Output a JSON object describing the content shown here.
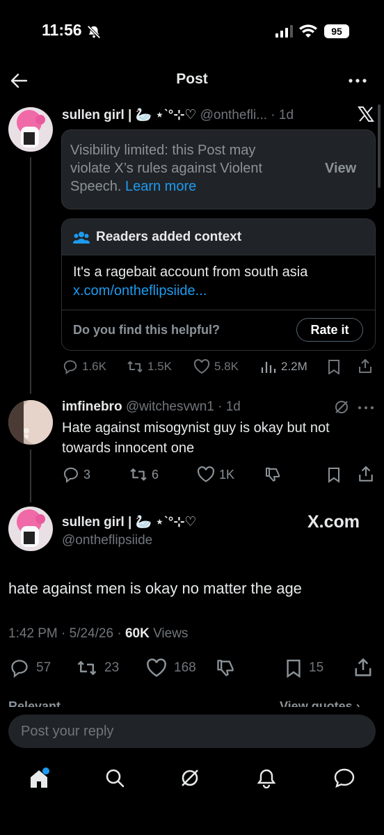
{
  "status_bar": {
    "time": "11:56",
    "battery": "95"
  },
  "header": {
    "title": "Post"
  },
  "post1": {
    "name": "sullen girl | 🦢 ⋆ˋ°⊹♡",
    "handle": "@onthefli...",
    "age": "· 1d",
    "limited": {
      "text_line1": "Visibility limited: this Post may",
      "text_line2": "violate X’s rules against Violent",
      "text_line3": "Speech.",
      "learn_more": "Learn more",
      "view_label": "View"
    },
    "context": {
      "title": "Readers added context",
      "text": "It's a ragebait account from south asia",
      "link": "x.com/ontheflipsiide...",
      "question": "Do you find this helpful?",
      "rate_label": "Rate it"
    },
    "actions": {
      "replies": "1.6K",
      "reposts": "1.5K",
      "likes": "5.8K",
      "views": "2.2M"
    }
  },
  "reply": {
    "name": "imfinebro",
    "handle": "@witchesvwn1",
    "age": "· 1d",
    "text_line1": "Hate against misogynist guy is okay but not",
    "text_line2": "towards innocent one",
    "actions": {
      "replies": "3",
      "reposts": "6",
      "likes": "1K"
    }
  },
  "main_post": {
    "name": "sullen girl | 🦢 ⋆ˋ°⊹♡",
    "handle": "@ontheflipsiide",
    "badge": "X.com",
    "text": "hate against men is okay no matter the age",
    "meta_time": "1:42 PM · 5/24/26 ·",
    "meta_views_count": "60K",
    "meta_views_label": "Views",
    "actions": {
      "replies": "57",
      "reposts": "23",
      "likes": "168",
      "bookmarks": "15"
    }
  },
  "sort": {
    "left": "Relevant",
    "right": "View quotes"
  },
  "reply_input": {
    "placeholder": "Post your reply"
  },
  "colors": {
    "accent": "#1d9bf0",
    "background": "#000000",
    "muted": "#71767b"
  }
}
